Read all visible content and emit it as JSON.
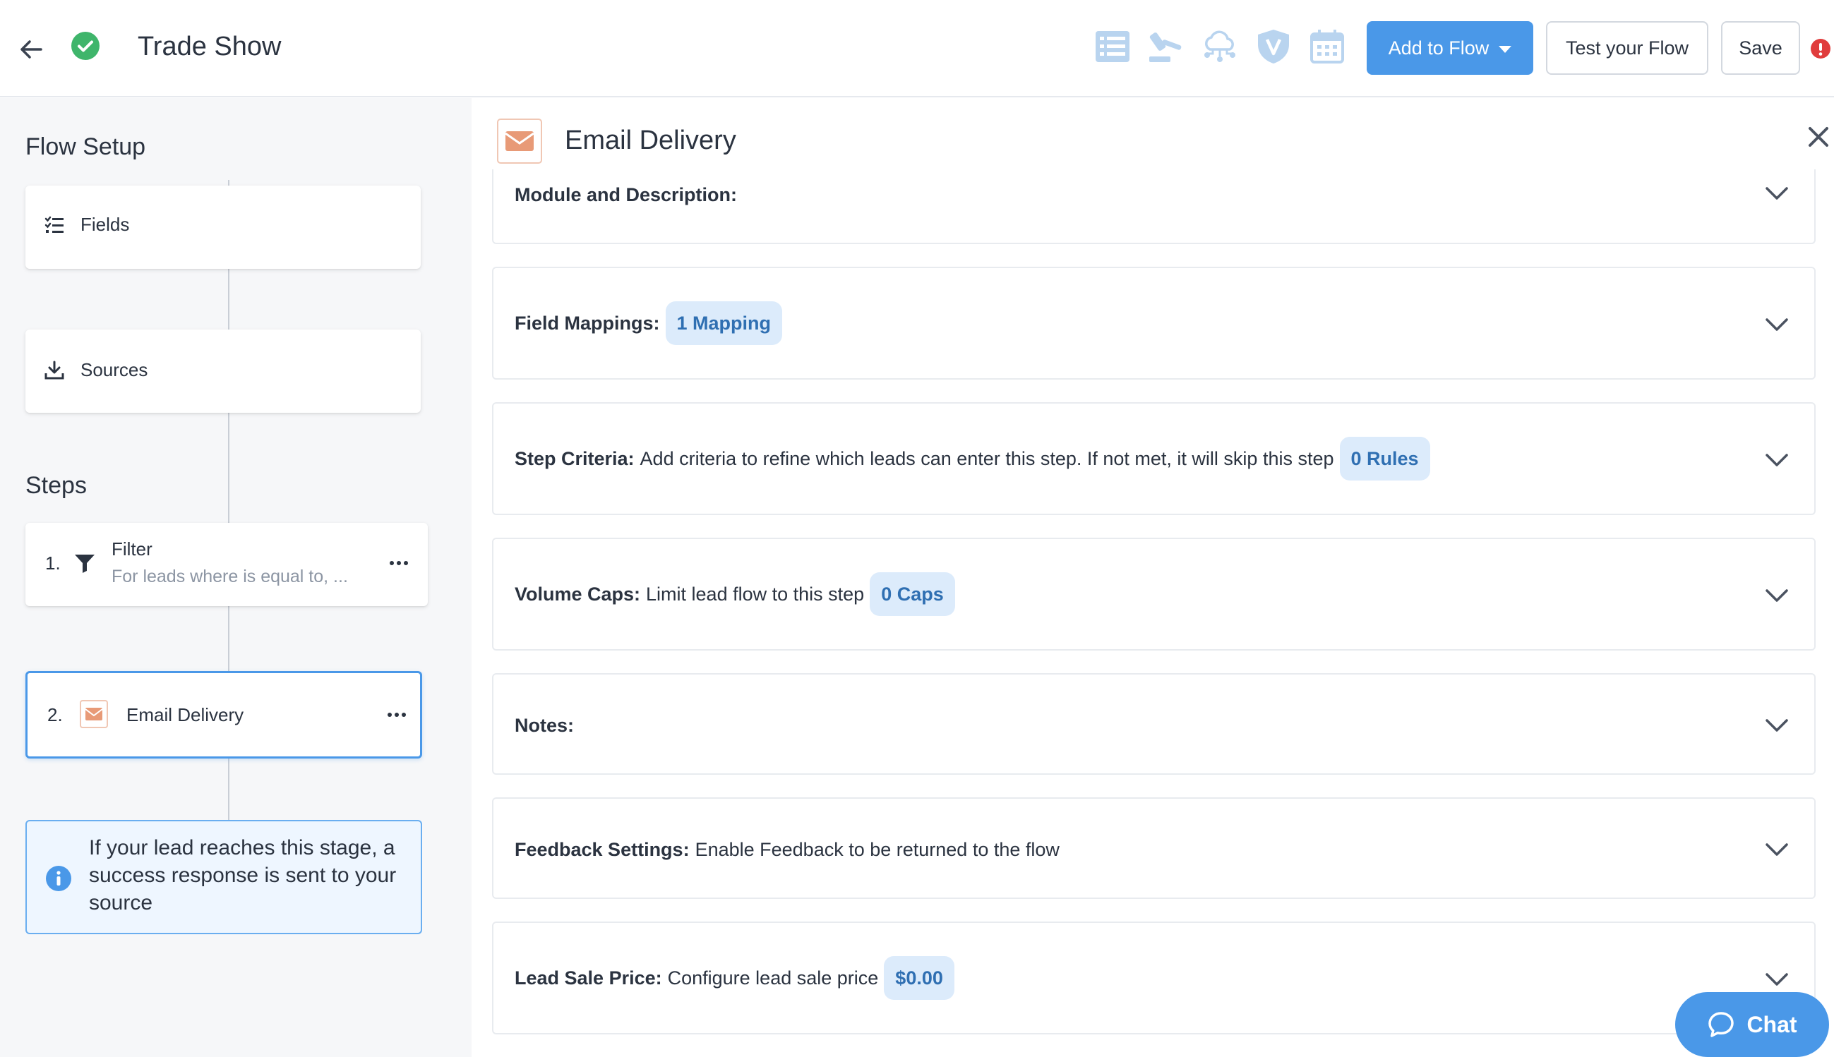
{
  "header": {
    "title": "Trade Show",
    "add_to_flow_label": "Add to Flow",
    "test_flow_label": "Test your Flow",
    "save_label": "Save"
  },
  "sidebar": {
    "flow_setup_heading": "Flow Setup",
    "fields_label": "Fields",
    "sources_label": "Sources",
    "steps_heading": "Steps",
    "steps": [
      {
        "number": "1.",
        "label": "Filter",
        "sublabel": "For leads where is equal to, ..."
      },
      {
        "number": "2.",
        "label": "Email Delivery"
      }
    ],
    "info_text": "If your lead reaches this stage, a success response is sent to your source"
  },
  "panel": {
    "title": "Email Delivery",
    "sections": [
      {
        "label": "Module and Description:"
      },
      {
        "label": "Field Mappings:",
        "pill": "1 Mapping"
      },
      {
        "label": "Step Criteria:",
        "description": "Add criteria to refine which leads can enter this step. If not met, it will skip this step",
        "pill": "0 Rules"
      },
      {
        "label": "Volume Caps:",
        "description": "Limit lead flow to this step",
        "pill": "0 Caps"
      },
      {
        "label": "Notes:"
      },
      {
        "label": "Feedback Settings:",
        "description": "Enable Feedback to be returned to the flow"
      },
      {
        "label": "Lead Sale Price:",
        "description": "Configure lead sale price",
        "pill": "$0.00"
      }
    ]
  },
  "chat": {
    "label": "Chat"
  },
  "colors": {
    "primary": "#4a98e8",
    "success": "#3fb56b",
    "alert": "#e03c3c",
    "email_accent": "#e89a77",
    "pill_bg": "#dcebfb",
    "pill_text": "#2f6fb2",
    "toolbar_icon": "#b9d4ef"
  },
  "icons": {
    "back": "arrow-left-icon",
    "status": "check-circle-icon",
    "toolbar": [
      "list-icon",
      "gavel-icon",
      "cloud-network-icon",
      "shield-v-icon",
      "calendar-icon"
    ],
    "alert": "exclamation-circle-icon",
    "fields": "checklist-icon",
    "sources": "download-icon",
    "filter": "funnel-icon",
    "email": "envelope-icon",
    "info": "info-circle-icon",
    "close": "close-icon",
    "expand": "chevron-down-icon",
    "chat": "speech-bubble-icon"
  }
}
